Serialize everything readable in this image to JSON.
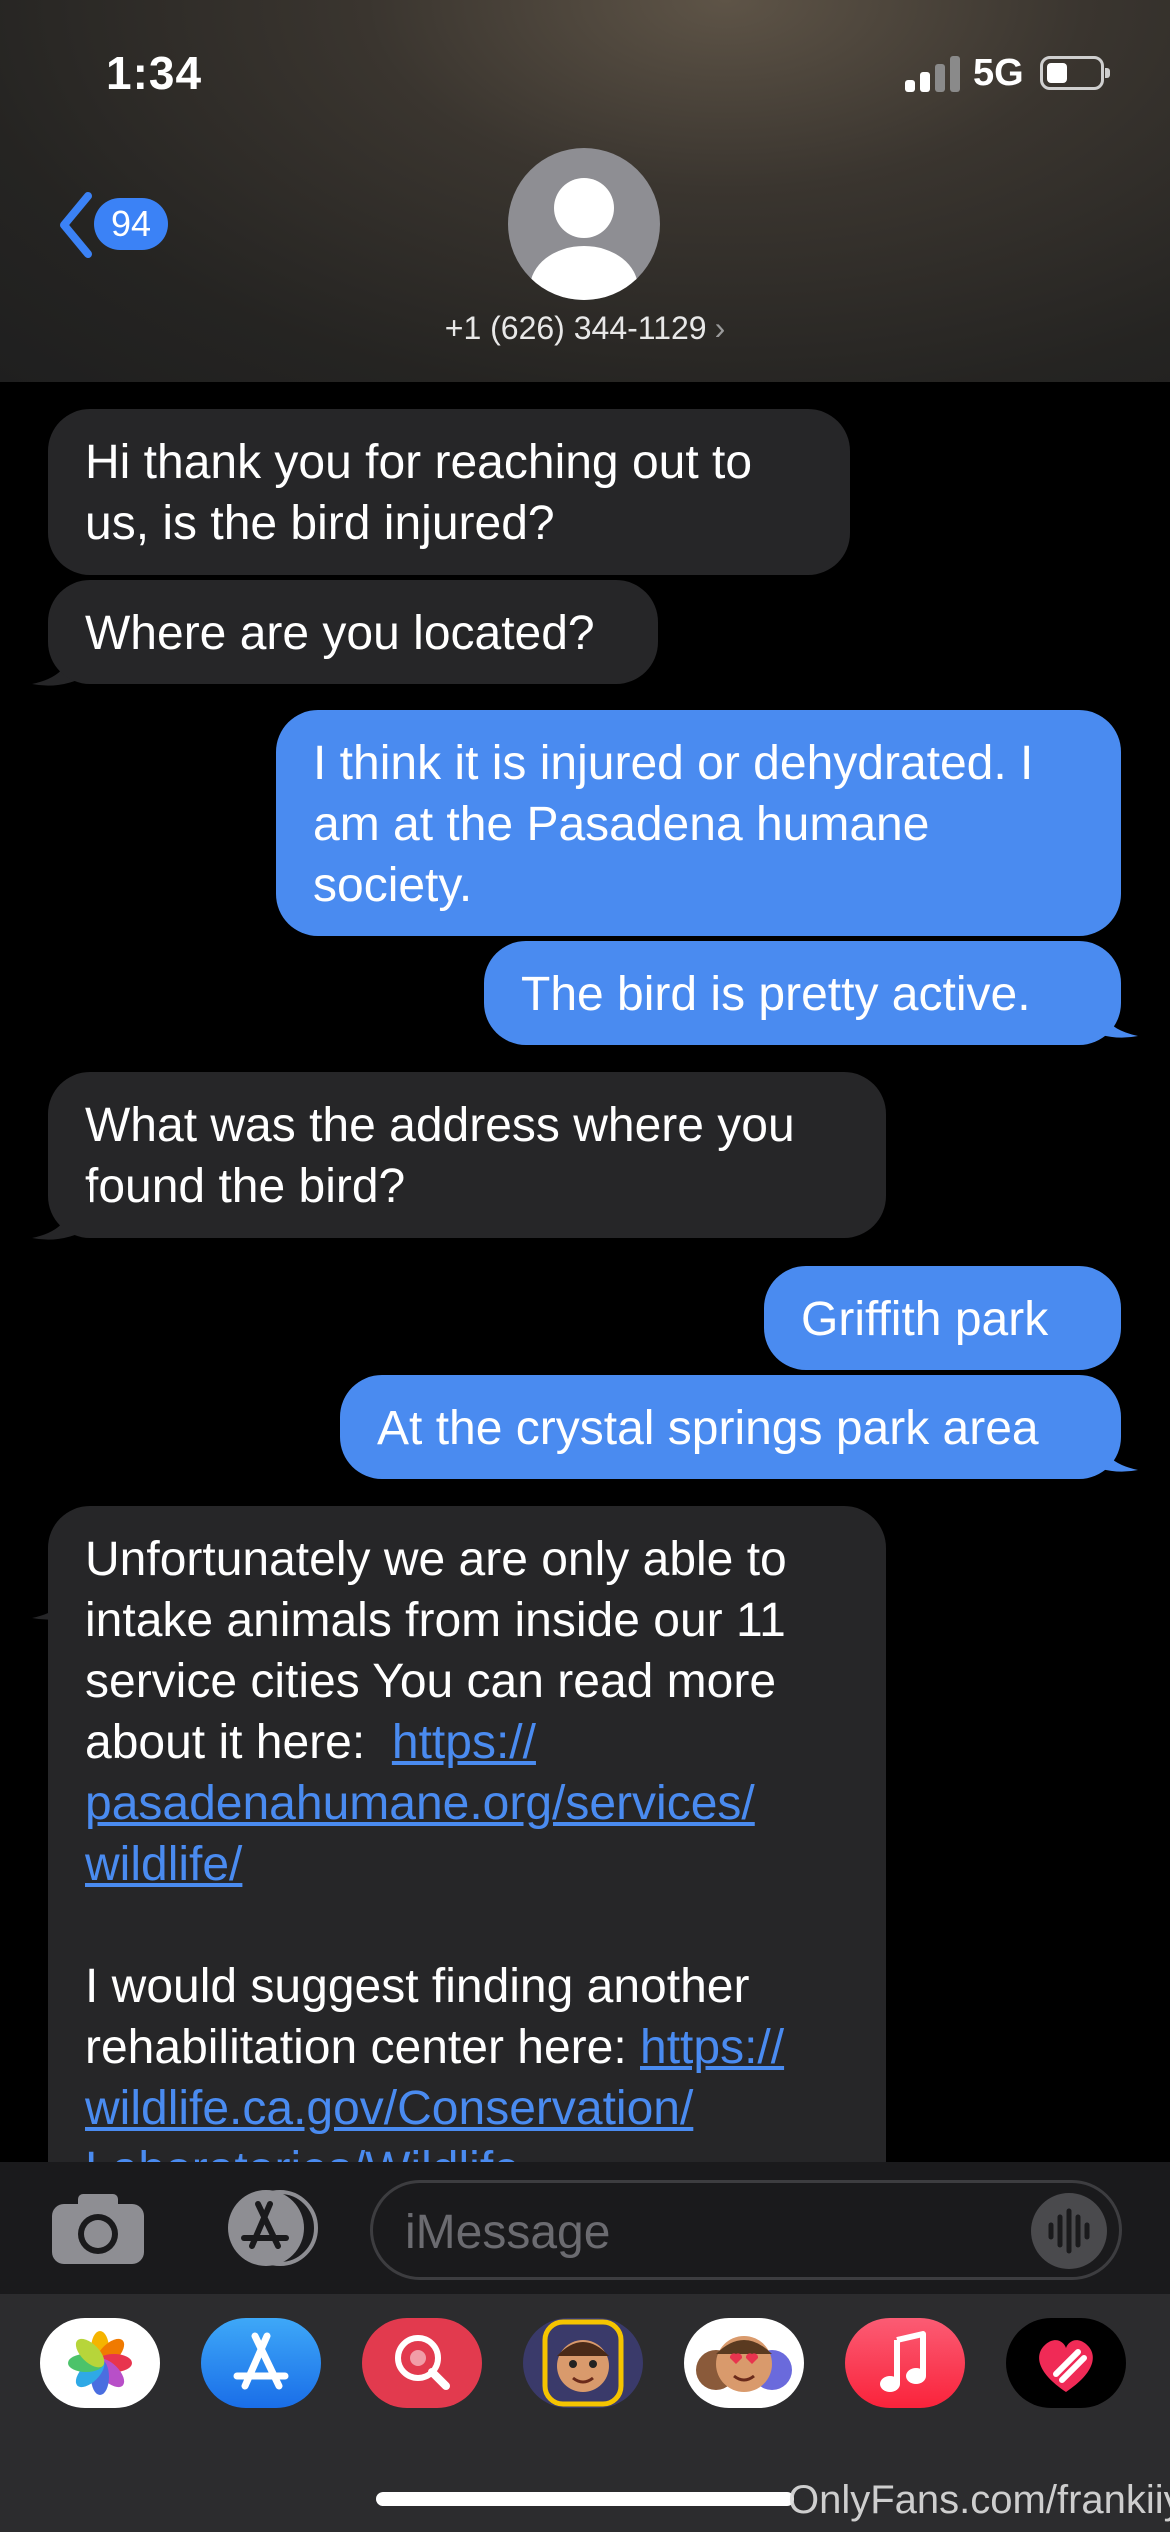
{
  "status_bar": {
    "time": "1:34",
    "network": "5G"
  },
  "header": {
    "back_badge": "94",
    "contact_name": "+1 (626) 344-1129",
    "chevron": "›"
  },
  "messages": [
    {
      "dir": "in",
      "text": "Hi thank you for reaching out to\nus, is the bird injured?"
    },
    {
      "dir": "in",
      "text": "Where are you located?"
    },
    {
      "dir": "out",
      "text": "I think it is injured or dehydrated. I\nam at the Pasadena humane\nsociety."
    },
    {
      "dir": "out",
      "text": "The bird is pretty active."
    },
    {
      "dir": "in",
      "text": "What was the address where you\nfound the bird?"
    },
    {
      "dir": "out",
      "text": "Griffith park"
    },
    {
      "dir": "out",
      "text": "At the crystal springs park area"
    },
    {
      "dir": "in",
      "text_intro": "Unfortunately we are only able to\nintake animals from inside our 11\nservice cities You can read more\nabout it here:  ",
      "link1": "https://\npasadenahumane.org/services/\nwildlife/",
      "text_mid": "\n\nI would suggest finding another\nrehabilitation center here: ",
      "link2": "https://\nwildlife.ca.gov/Conservation/\nLaboratories/Wildlife-"
    }
  ],
  "input": {
    "placeholder": "iMessage"
  },
  "icons": {
    "camera": "camera-icon",
    "app_store": "app-store-icon",
    "audio": "waveform-icon",
    "drawer": [
      "photos-icon",
      "app-store-icon",
      "images-search-icon",
      "memoji-icon",
      "animoji-icon",
      "music-icon",
      "heart-stickers-icon"
    ]
  },
  "colors": {
    "outgoing": "#4a8bf0",
    "incoming": "#262628",
    "link": "#4a8bf0",
    "badge": "#3b82f6"
  },
  "watermark": "OnlyFans.com/frankiiy_"
}
